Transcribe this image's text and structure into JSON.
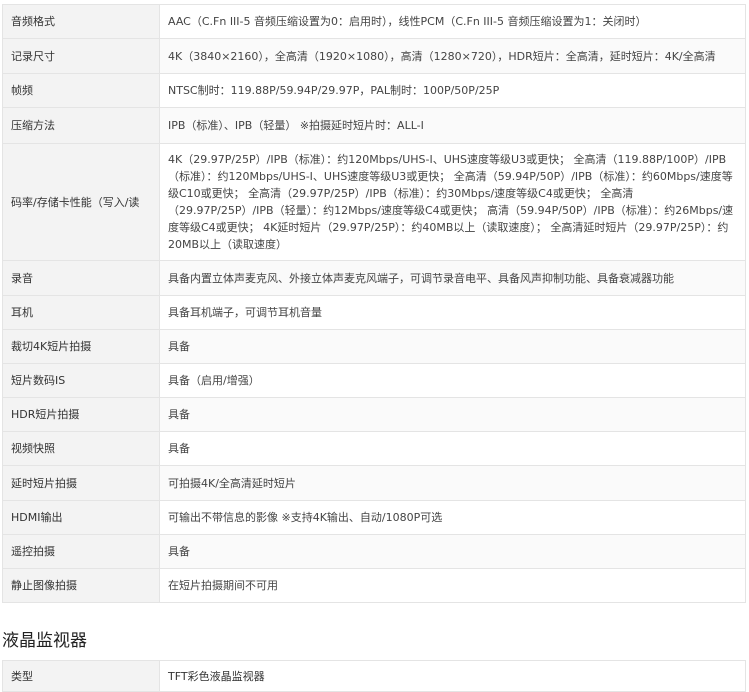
{
  "spec_rows": [
    {
      "label": "音频格式",
      "value": "AAC（C.Fn III-5 音频压缩设置为0：启用时），线性PCM（C.Fn III-5 音频压缩设置为1：关闭时）"
    },
    {
      "label": "记录尺寸",
      "value": "4K（3840×2160），全高清（1920×1080），高清（1280×720），HDR短片：全高清，延时短片：4K/全高清"
    },
    {
      "label": "帧频",
      "value": "NTSC制时：119.88P/59.94P/29.97P，PAL制时：100P/50P/25P"
    },
    {
      "label": "压缩方法",
      "value": "IPB（标准）、IPB（轻量） ※拍摄延时短片时：ALL-I"
    },
    {
      "label": "码率/存储卡性能（写入/读",
      "value": "4K（29.97P/25P）/IPB（标准）：约120Mbps/UHS-I、UHS速度等级U3或更快； 全高清（119.88P/100P）/IPB（标准）：约120Mbps/UHS-I、UHS速度等级U3或更快； 全高清（59.94P/50P）/IPB（标准）：约60Mbps/速度等级C10或更快； 全高清（29.97P/25P）/IPB（标准）：约30Mbps/速度等级C4或更快； 全高清（29.97P/25P）/IPB（轻量）：约12Mbps/速度等级C4或更快； 高清（59.94P/50P）/IPB（标准）：约26Mbps/速度等级C4或更快； 4K延时短片（29.97P/25P）：约40MB以上（读取速度）； 全高清延时短片（29.97P/25P）：约20MB以上（读取速度）"
    },
    {
      "label": "录音",
      "value": "具备内置立体声麦克风、外接立体声麦克风端子，可调节录音电平、具备风声抑制功能、具备衰减器功能"
    },
    {
      "label": "耳机",
      "value": "具备耳机端子，可调节耳机音量"
    },
    {
      "label": "裁切4K短片拍摄",
      "value": "具备"
    },
    {
      "label": "短片数码IS",
      "value": "具备（启用/增强）"
    },
    {
      "label": "HDR短片拍摄",
      "value": "具备"
    },
    {
      "label": "视频快照",
      "value": "具备"
    },
    {
      "label": "延时短片拍摄",
      "value": "可拍摄4K/全高清延时短片"
    },
    {
      "label": "HDMI输出",
      "value": "可输出不带信息的影像 ※支持4K输出、自动/1080P可选"
    },
    {
      "label": "遥控拍摄",
      "value": "具备"
    },
    {
      "label": "静止图像拍摄",
      "value": "在短片拍摄期间不可用"
    }
  ],
  "section": {
    "title": "液晶监视器",
    "first_row": {
      "label": "类型",
      "value": "TFT彩色液晶监视器"
    }
  }
}
